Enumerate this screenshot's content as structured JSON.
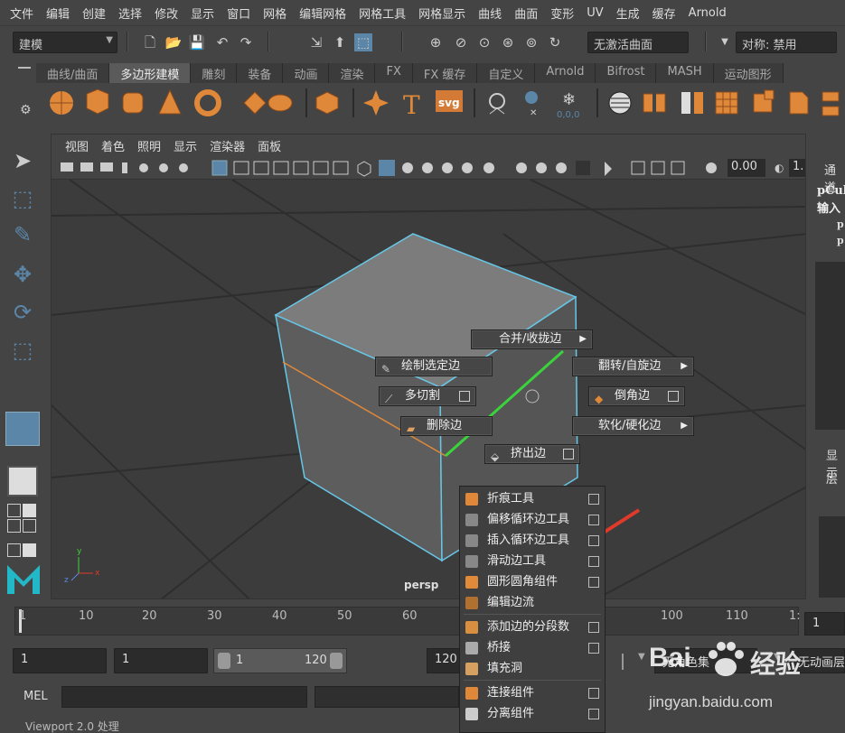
{
  "menubar": [
    "文件",
    "编辑",
    "创建",
    "选择",
    "修改",
    "显示",
    "窗口",
    "网格",
    "编辑网格",
    "网格工具",
    "网格显示",
    "曲线",
    "曲面",
    "变形",
    "UV",
    "生成",
    "缓存",
    "Arnold"
  ],
  "status": {
    "mode": "建模",
    "live_surface": "无激活曲面",
    "symmetry": "对称: 禁用"
  },
  "shelf_tabs": [
    "曲线/曲面",
    "多边形建模",
    "雕刻",
    "装备",
    "动画",
    "渲染",
    "FX",
    "FX 缓存",
    "自定义",
    "Arnold",
    "Bifrost",
    "MASH",
    "运动图形"
  ],
  "shelf_active_index": 1,
  "shelf_text_icons": {
    "text_tool": "T",
    "svg_tool": "svg",
    "coords": "0,0,0"
  },
  "viewport": {
    "menu": [
      "视图",
      "着色",
      "照明",
      "显示",
      "渲染器",
      "面板"
    ],
    "field_value": "0.00",
    "field2_value": "1.",
    "camera_label": "persp"
  },
  "channelbox": {
    "title": "通道",
    "object": "pCub",
    "inputs": "输入",
    "lines": [
      "p",
      "p"
    ],
    "display": "显示",
    "layer": "层"
  },
  "hotbox": {
    "merge": "合并/收拢边",
    "paint_select": "绘制选定边",
    "flip_spin": "翻转/自旋边",
    "multicut": "多切割",
    "bevel": "倒角边",
    "delete_edge": "删除边",
    "soften_harden": "软化/硬化边",
    "extrude_edge": "挤出边"
  },
  "popup_items": [
    {
      "label": "折痕工具",
      "color": "#e0883a"
    },
    {
      "label": "偏移循环边工具",
      "color": "#888"
    },
    {
      "label": "插入循环边工具",
      "color": "#888"
    },
    {
      "label": "滑动边工具",
      "color": "#888"
    },
    {
      "label": "圆形圆角组件",
      "color": "#e08a3a"
    },
    {
      "label": "编辑边流",
      "color": "#b07030"
    },
    {
      "label": "添加边的分段数",
      "color": "#d89040"
    },
    {
      "label": "桥接",
      "color": "#aaa"
    },
    {
      "label": "填充洞",
      "color": "#d8a060"
    },
    {
      "label": "连接组件",
      "color": "#e0883a"
    },
    {
      "label": "分离组件",
      "color": "#ccc"
    }
  ],
  "timeline": {
    "ticks": [
      "1",
      "10",
      "20",
      "30",
      "40",
      "50",
      "60",
      "100",
      "110",
      "1:"
    ],
    "current_frame": "1"
  },
  "range": {
    "start": "1",
    "start2": "1",
    "slider_start": "1",
    "slider_end": "120",
    "end": "120",
    "char_set": "无角色集",
    "anim_layer": "无动画层"
  },
  "mel": {
    "label": "MEL"
  },
  "help": {
    "text": "Viewport 2.0 处理"
  },
  "watermark": {
    "brand": "Bai",
    "brand2": "经验",
    "url": "jingyan.baidu.com"
  },
  "colors": {
    "accent": "#5b86a8",
    "wire": "#67c6e6",
    "edge_green": "#3bd33b",
    "orange": "#e0883a",
    "arrow": "#e03a2a"
  }
}
